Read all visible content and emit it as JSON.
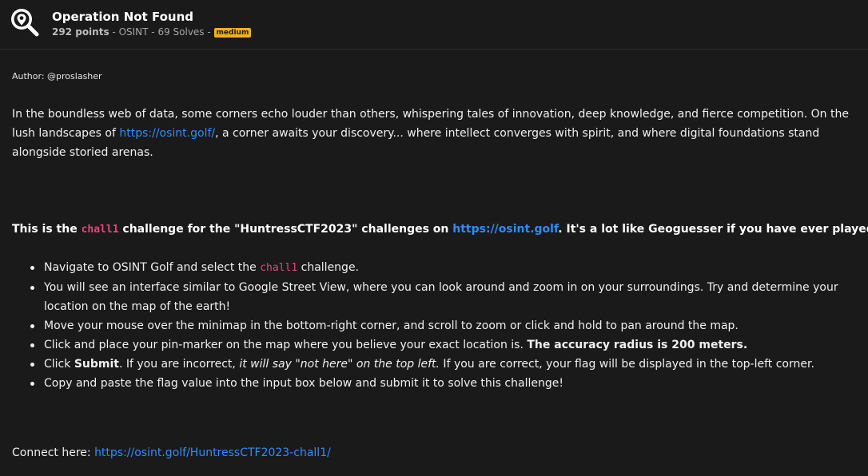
{
  "challenge": {
    "title": "Operation Not Found",
    "points": "292 points",
    "category_sep": " - OSINT - ",
    "solves": "69 Solves",
    "solves_sep": " - ",
    "difficulty": "medium",
    "icon": "magnifier-pin-icon"
  },
  "description": {
    "author": "Author: @proslasher",
    "intro_part1": "In the boundless web of data, some corners echo louder than others, whispering tales of innovation, deep knowledge, and fierce competition. On the lush landscapes of ",
    "intro_link": "https://osint.golf/",
    "intro_part2": ", a corner awaits your discovery... where intellect converges with spirit, and where digital foundations stand alongside storied arenas.",
    "bold_part1": "This is the ",
    "bold_code": "chall1",
    "bold_part2": " challenge for the \"HuntressCTF2023\" challenges on ",
    "bold_link": "https://osint.golf",
    "bold_part3": ". It's a lot like Geoguesser if you have ever played :)",
    "steps": {
      "s1_part1": "Navigate to OSINT Golf and select the ",
      "s1_code": "chall1",
      "s1_part2": " challenge.",
      "s2": "You will see an interface similar to Google Street View, where you can look around and zoom in on your surroundings. Try and determine your location on the map of the earth!",
      "s3": "Move your mouse over the minimap in the bottom-right corner, and scroll to zoom or click and hold to pan around the map.",
      "s4_part1": "Click and place your pin-marker on the map where you believe your exact location is. ",
      "s4_bold": "The accuracy radius is 200 meters.",
      "s5_part1": "Click ",
      "s5_bold": "Submit",
      "s5_part2": ". If you are incorrect, ",
      "s5_italic": "it will say \"not here\" on the top left.",
      "s5_part3": " If you are correct, your flag will be displayed in the top-left corner.",
      "s6": "Copy and paste the flag value into the input box below and submit it to solve this challenge!"
    },
    "connect_label": "Connect here: ",
    "connect_link": "https://osint.golf/HuntressCTF2023-chall1/"
  },
  "colors": {
    "background": "#1a1a1a",
    "link": "#2f8cff",
    "code": "#e8447c",
    "badge": "#f2b01e"
  }
}
